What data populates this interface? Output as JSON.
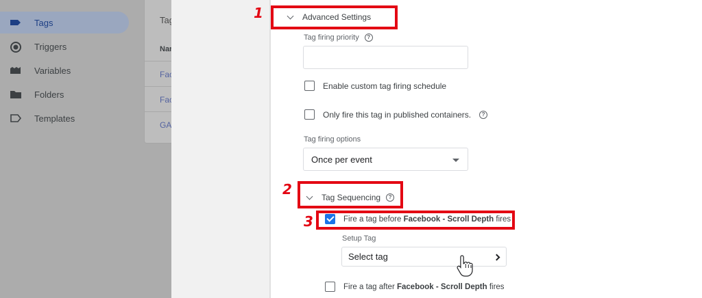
{
  "sidebar": {
    "items": [
      {
        "label": "Tags",
        "icon": "tag-icon"
      },
      {
        "label": "Triggers",
        "icon": "trigger-icon"
      },
      {
        "label": "Variables",
        "icon": "variables-icon"
      },
      {
        "label": "Folders",
        "icon": "folder-icon"
      },
      {
        "label": "Templates",
        "icon": "template-icon"
      }
    ]
  },
  "tags_card": {
    "title": "Tag",
    "column_header": "Nan",
    "rows": [
      "Fac",
      "Fac",
      "GA"
    ]
  },
  "advanced": {
    "title": "Advanced Settings",
    "priority_label": "Tag firing priority",
    "priority_value": "",
    "custom_schedule_label": "Enable custom tag firing schedule",
    "published_only_label": "Only fire this tag in published containers.",
    "firing_options_label": "Tag firing options",
    "firing_options_value": "Once per event"
  },
  "sequencing": {
    "title": "Tag Sequencing",
    "before": {
      "prefix": "Fire a tag before ",
      "tag": "Facebook - Scroll Depth",
      "suffix": " fires",
      "checked": true
    },
    "setup_label": "Setup Tag",
    "setup_value": "Select tag",
    "after": {
      "prefix": "Fire a tag after ",
      "tag": "Facebook - Scroll Depth",
      "suffix": " fires",
      "checked": false
    }
  },
  "markers": [
    "1",
    "2",
    "3"
  ],
  "colors": {
    "annotation": "#e30613",
    "checkbox_checked": "#1a73e8",
    "active_nav": "#1d3f84"
  }
}
